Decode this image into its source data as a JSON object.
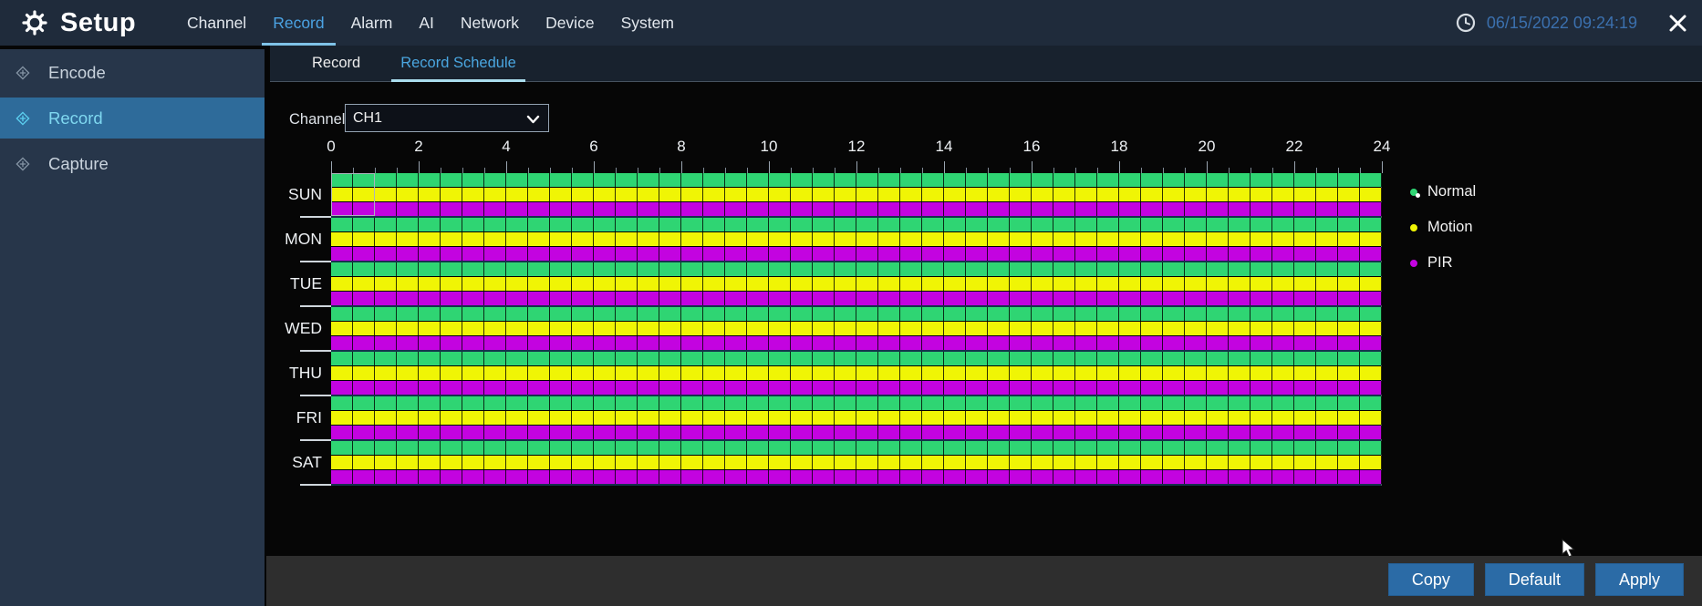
{
  "header": {
    "app_title": "Setup",
    "menu_items": [
      {
        "label": "Channel",
        "active": false
      },
      {
        "label": "Record",
        "active": true
      },
      {
        "label": "Alarm",
        "active": false
      },
      {
        "label": "AI",
        "active": false
      },
      {
        "label": "Network",
        "active": false
      },
      {
        "label": "Device",
        "active": false
      },
      {
        "label": "System",
        "active": false
      }
    ],
    "datetime": "06/15/2022 09:24:19",
    "icons": {
      "gear": "gear-icon",
      "clock": "clock-icon",
      "close": "close-icon",
      "chevron": "chevron-down-icon"
    }
  },
  "sidebar": {
    "items": [
      {
        "label": "Encode",
        "selected": false
      },
      {
        "label": "Record",
        "selected": true
      },
      {
        "label": "Capture",
        "selected": false
      }
    ]
  },
  "tabs": [
    {
      "label": "Record",
      "active": false
    },
    {
      "label": "Record Schedule",
      "active": true
    }
  ],
  "channel": {
    "label": "Channel",
    "value": "CH1"
  },
  "schedule": {
    "hour_labels": [
      "0",
      "2",
      "4",
      "6",
      "8",
      "10",
      "12",
      "14",
      "16",
      "18",
      "20",
      "22",
      "24"
    ],
    "hours_range": [
      0,
      24
    ],
    "cells_per_row": 48,
    "days": [
      "SUN",
      "MON",
      "TUE",
      "WED",
      "THU",
      "FRI",
      "SAT"
    ],
    "modes": [
      {
        "name": "Normal",
        "color": "#2fd573"
      },
      {
        "name": "Motion",
        "color": "#f0f505"
      },
      {
        "name": "PIR",
        "color": "#c303e0"
      }
    ],
    "filled": {
      "SUN": {
        "Normal": [
          [
            0,
            24
          ]
        ],
        "Motion": [
          [
            0,
            24
          ]
        ],
        "PIR": [
          [
            0,
            24
          ]
        ]
      },
      "MON": {
        "Normal": [
          [
            0,
            24
          ]
        ],
        "Motion": [
          [
            0,
            24
          ]
        ],
        "PIR": [
          [
            0,
            24
          ]
        ]
      },
      "TUE": {
        "Normal": [
          [
            0,
            24
          ]
        ],
        "Motion": [
          [
            0,
            24
          ]
        ],
        "PIR": [
          [
            0,
            24
          ]
        ]
      },
      "WED": {
        "Normal": [
          [
            0,
            24
          ]
        ],
        "Motion": [
          [
            0,
            24
          ]
        ],
        "PIR": [
          [
            0,
            24
          ]
        ]
      },
      "THU": {
        "Normal": [
          [
            0,
            24
          ]
        ],
        "Motion": [
          [
            0,
            24
          ]
        ],
        "PIR": [
          [
            0,
            24
          ]
        ]
      },
      "FRI": {
        "Normal": [
          [
            0,
            24
          ]
        ],
        "Motion": [
          [
            0,
            24
          ]
        ],
        "PIR": [
          [
            0,
            24
          ]
        ]
      },
      "SAT": {
        "Normal": [
          [
            0,
            24
          ]
        ],
        "Motion": [
          [
            0,
            24
          ]
        ],
        "PIR": [
          [
            0,
            24
          ]
        ]
      }
    },
    "selection": {
      "day": "SUN",
      "start_hour": 0,
      "end_hour": 1
    }
  },
  "legend": [
    {
      "label": "Normal",
      "color": "#2fd573",
      "selected": true
    },
    {
      "label": "Motion",
      "color": "#f0f505",
      "selected": false
    },
    {
      "label": "PIR",
      "color": "#c303e0",
      "selected": false
    }
  ],
  "footer": {
    "buttons": [
      {
        "label": "Copy"
      },
      {
        "label": "Default"
      },
      {
        "label": "Apply"
      }
    ]
  }
}
